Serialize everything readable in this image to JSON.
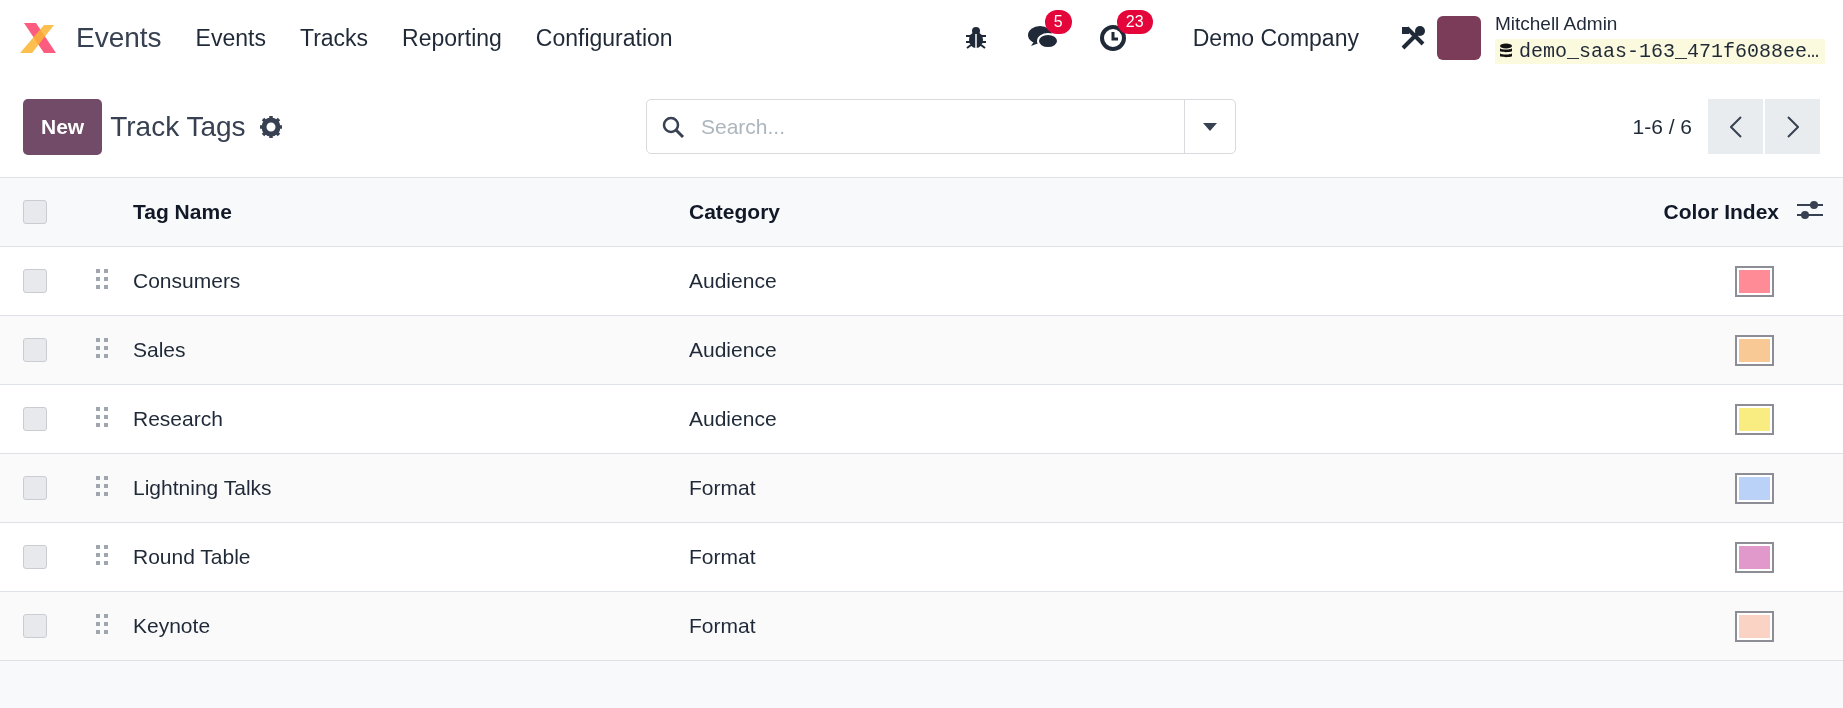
{
  "navbar": {
    "app_name": "Events",
    "menu": [
      "Events",
      "Tracks",
      "Reporting",
      "Configuration"
    ],
    "messages_count": "5",
    "activities_count": "23",
    "company": "Demo Company",
    "user_name": "Mitchell Admin",
    "database": "demo_saas-163_471f6088ee…"
  },
  "control_panel": {
    "new_button": "New",
    "title": "Track Tags",
    "search": {
      "placeholder": "Search..."
    },
    "pager": "1-6 / 6"
  },
  "table": {
    "select_all_checked": false,
    "columns": [
      "Tag Name",
      "Category",
      "Color Index"
    ],
    "rows": [
      {
        "checked": false,
        "tag_name": "Consumers",
        "category": "Audience",
        "color": "#ff8b96"
      },
      {
        "checked": false,
        "tag_name": "Sales",
        "category": "Audience",
        "color": "#f9c995"
      },
      {
        "checked": false,
        "tag_name": "Research",
        "category": "Audience",
        "color": "#f9ec80"
      },
      {
        "checked": false,
        "tag_name": "Lightning Talks",
        "category": "Format",
        "color": "#bbd2f8"
      },
      {
        "checked": false,
        "tag_name": "Round Table",
        "category": "Format",
        "color": "#e199cc"
      },
      {
        "checked": false,
        "tag_name": "Keynote",
        "category": "Format",
        "color": "#fbd3c5"
      }
    ]
  }
}
